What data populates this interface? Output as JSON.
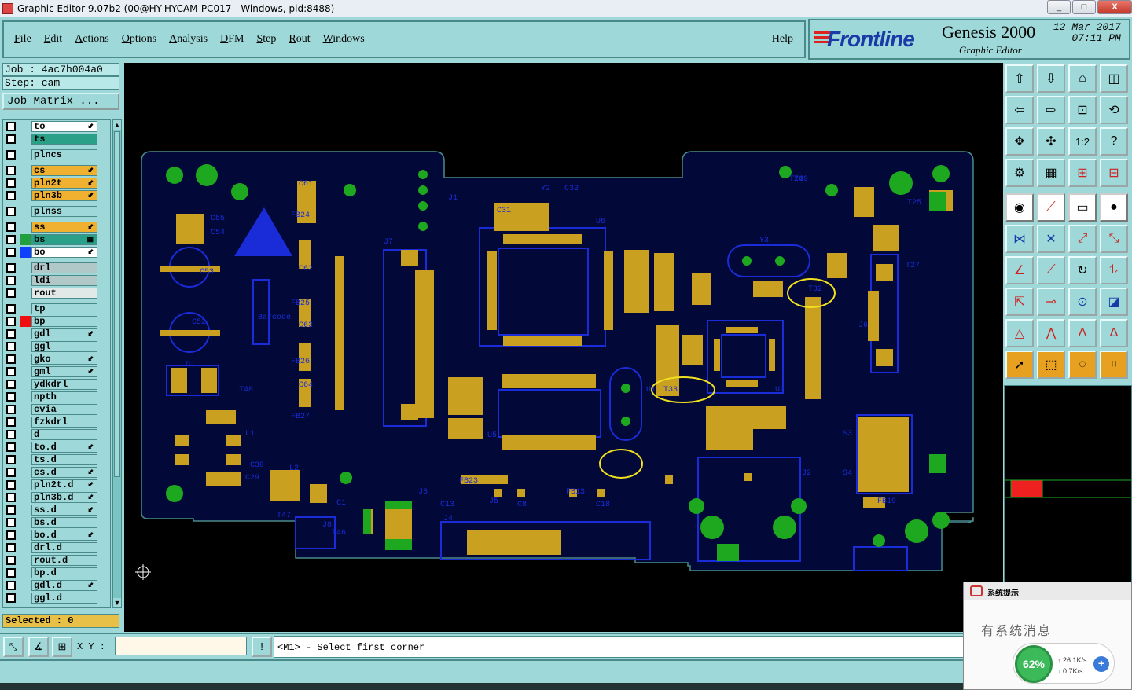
{
  "window": {
    "title": "Graphic Editor 9.07b2 (00@HY-HYCAM-PC017 - Windows, pid:8488)",
    "buttons": [
      "_",
      "□",
      "X"
    ]
  },
  "menu": {
    "items": [
      "File",
      "Edit",
      "Actions",
      "Options",
      "Analysis",
      "DFM",
      "Step",
      "Rout",
      "Windows"
    ],
    "help": "Help"
  },
  "brand": {
    "logo": "Frontline",
    "product": "Genesis 2000",
    "subtitle": "Graphic Editor",
    "date_line1": "12 Mar 2017",
    "date_line2": "07:11 PM"
  },
  "job": {
    "job_label": "Job : 4ac7h004a0",
    "step_label": "Step: cam",
    "matrix_button": "Job Matrix ..."
  },
  "layers": [
    {
      "name": "to",
      "color": "#ffffff",
      "mark": "⬋",
      "gap_before": false
    },
    {
      "name": "ts",
      "color": "#2aa088",
      "mark": "",
      "gap_before": false
    },
    {
      "name": "plncs",
      "color": "#9ed8d8",
      "mark": "",
      "gap_before": true
    },
    {
      "name": "cs",
      "color": "#f0b030",
      "mark": "⬋",
      "gap_before": true
    },
    {
      "name": "pln2t",
      "color": "#f0b030",
      "mark": "⬋",
      "gap_before": false
    },
    {
      "name": "pln3b",
      "color": "#f0b030",
      "mark": "⬋",
      "gap_before": false
    },
    {
      "name": "plnss",
      "color": "#9ed8d8",
      "mark": "",
      "gap_before": true
    },
    {
      "name": "ss",
      "color": "#f0b030",
      "mark": "⬋",
      "gap_before": true
    },
    {
      "name": "bs",
      "color": "#2aa088",
      "mark": "▦",
      "gap_before": false,
      "swatch": "#20a040"
    },
    {
      "name": "bo",
      "color": "#ffffff",
      "mark": "⬋",
      "gap_before": false,
      "swatch": "#1040ff"
    },
    {
      "name": "drl",
      "color": "#b0c8c8",
      "mark": "",
      "gap_before": true
    },
    {
      "name": "ldi",
      "color": "#b0c8c8",
      "mark": "",
      "gap_before": false
    },
    {
      "name": "rout",
      "color": "#e0e8e8",
      "mark": "",
      "gap_before": false
    },
    {
      "name": "tp",
      "color": "#9ed8d8",
      "mark": "",
      "gap_before": true
    },
    {
      "name": "bp",
      "color": "#9ed8d8",
      "mark": "",
      "gap_before": false,
      "swatch": "#ee1010"
    },
    {
      "name": "gdl",
      "color": "#9ed8d8",
      "mark": "⬋",
      "gap_before": false
    },
    {
      "name": "ggl",
      "color": "#9ed8d8",
      "mark": "",
      "gap_before": false
    },
    {
      "name": "gko",
      "color": "#9ed8d8",
      "mark": "⬋",
      "gap_before": false
    },
    {
      "name": "gml",
      "color": "#9ed8d8",
      "mark": "⬋",
      "gap_before": false
    },
    {
      "name": "ydkdrl",
      "color": "#9ed8d8",
      "mark": "",
      "gap_before": false
    },
    {
      "name": "npth",
      "color": "#9ed8d8",
      "mark": "",
      "gap_before": false
    },
    {
      "name": "cvia",
      "color": "#9ed8d8",
      "mark": "",
      "gap_before": false
    },
    {
      "name": "fzkdrl",
      "color": "#9ed8d8",
      "mark": "",
      "gap_before": false
    },
    {
      "name": "d",
      "color": "#9ed8d8",
      "mark": "",
      "gap_before": false
    },
    {
      "name": "to.d",
      "color": "#9ed8d8",
      "mark": "⬋",
      "gap_before": false
    },
    {
      "name": "ts.d",
      "color": "#9ed8d8",
      "mark": "",
      "gap_before": false
    },
    {
      "name": "cs.d",
      "color": "#9ed8d8",
      "mark": "⬋",
      "gap_before": false
    },
    {
      "name": "pln2t.d",
      "color": "#9ed8d8",
      "mark": "⬋",
      "gap_before": false
    },
    {
      "name": "pln3b.d",
      "color": "#9ed8d8",
      "mark": "⬋",
      "gap_before": false
    },
    {
      "name": "ss.d",
      "color": "#9ed8d8",
      "mark": "⬋",
      "gap_before": false
    },
    {
      "name": "bs.d",
      "color": "#9ed8d8",
      "mark": "",
      "gap_before": false
    },
    {
      "name": "bo.d",
      "color": "#9ed8d8",
      "mark": "⬋",
      "gap_before": false
    },
    {
      "name": "drl.d",
      "color": "#9ed8d8",
      "mark": "",
      "gap_before": false
    },
    {
      "name": "rout.d",
      "color": "#9ed8d8",
      "mark": "",
      "gap_before": false
    },
    {
      "name": "bp.d",
      "color": "#9ed8d8",
      "mark": "",
      "gap_before": false
    },
    {
      "name": "gdl.d",
      "color": "#9ed8d8",
      "mark": "⬋",
      "gap_before": false
    },
    {
      "name": "ggl.d",
      "color": "#9ed8d8",
      "mark": "",
      "gap_before": false
    }
  ],
  "status": {
    "selected": "Selected : 0",
    "xy_label": "X Y :",
    "xy_value": "",
    "prompt": "<M1> - Select first corner"
  },
  "notification": {
    "header": "系统提示",
    "message": "有系统消息",
    "cpu_percent": "62%",
    "upload_rate": "26.1K/s",
    "download_rate": "0.7K/s"
  },
  "pcb": {
    "ref_labels": [
      "J1",
      "J2",
      "J3",
      "J4",
      "J5",
      "J6",
      "J7",
      "J8",
      "U1",
      "U2",
      "U5",
      "U6",
      "Y2",
      "Y3",
      "D1",
      "L1",
      "L2",
      "T25",
      "T26",
      "T27",
      "T32",
      "T33",
      "T46",
      "T47",
      "T48",
      "T49",
      "C1",
      "C8",
      "C13",
      "C18",
      "C29",
      "C30",
      "C31",
      "C32",
      "C52",
      "C53",
      "C54",
      "C55",
      "C61",
      "C62",
      "C63",
      "C64",
      "FB13",
      "FB19",
      "FB23",
      "FB24",
      "FB25",
      "FB26",
      "FB27",
      "S3",
      "S4",
      "Barcode"
    ]
  }
}
